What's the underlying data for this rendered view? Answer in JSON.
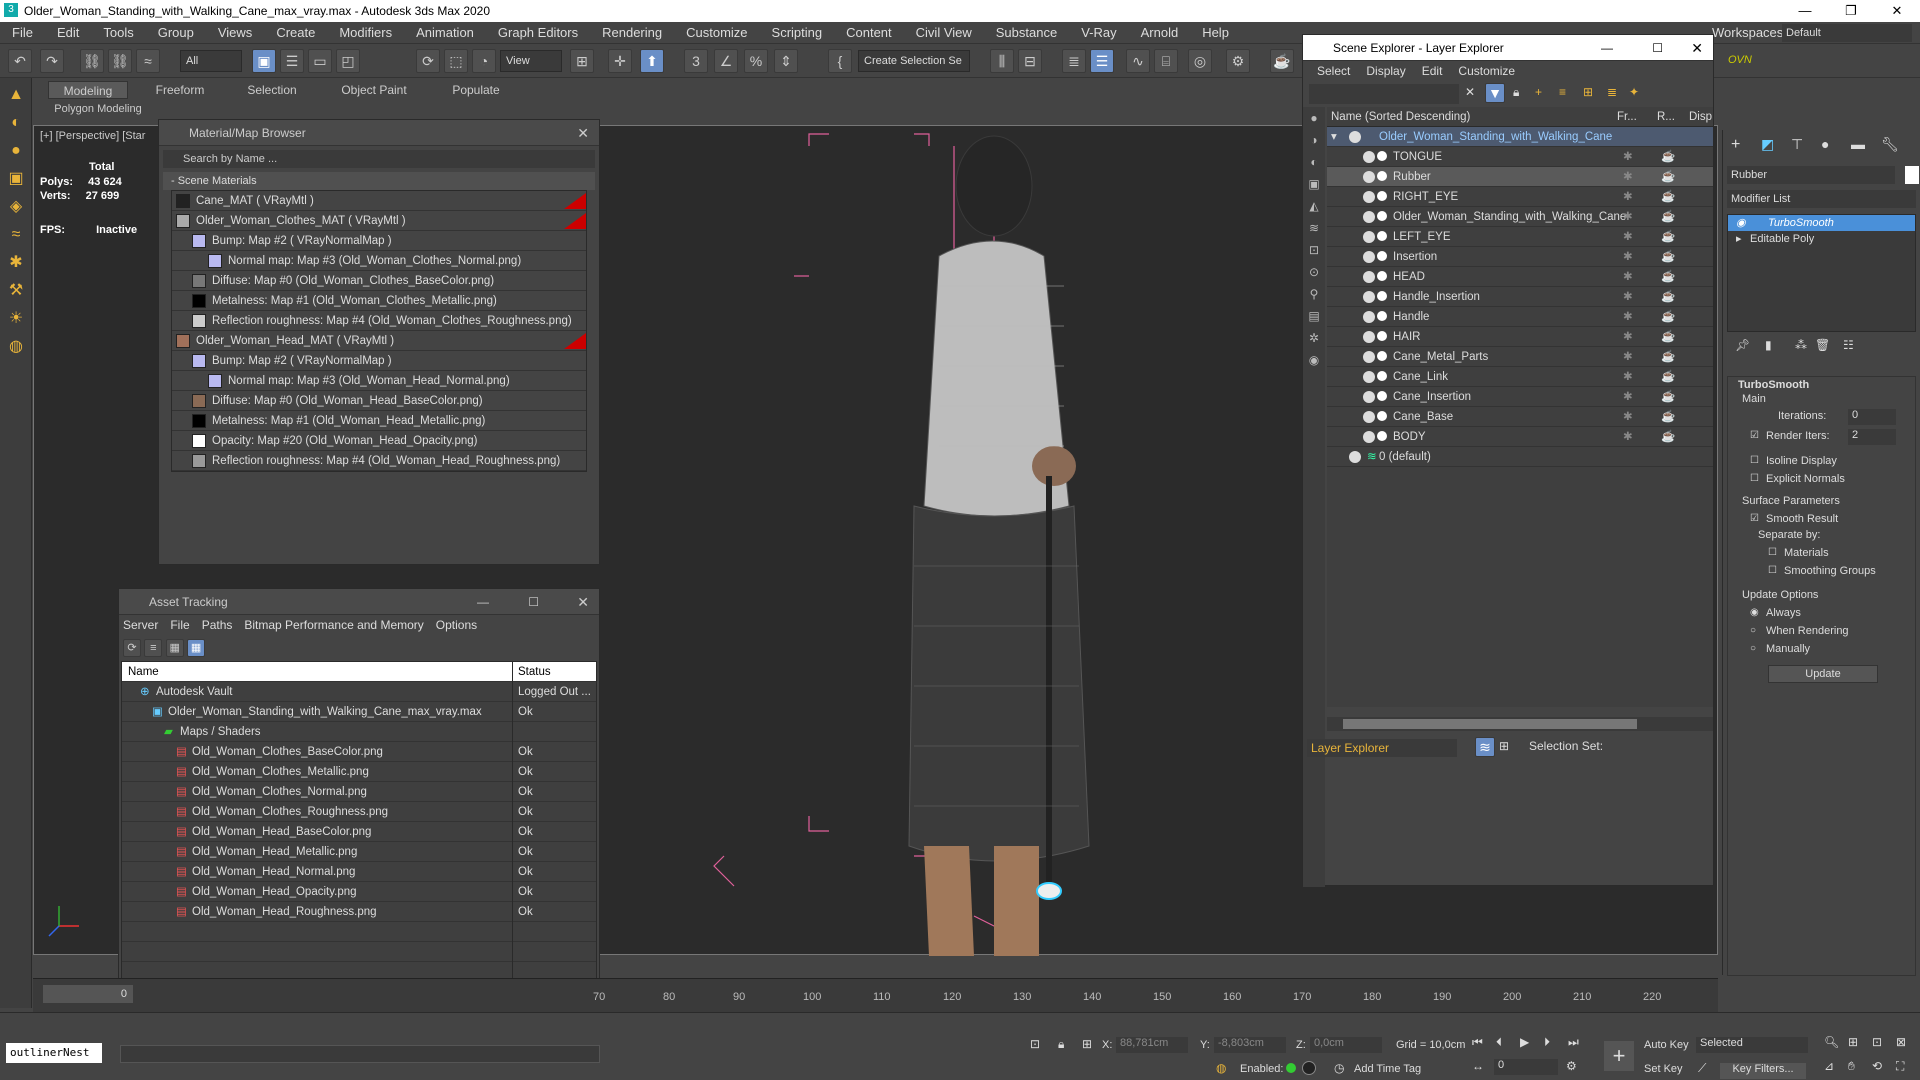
{
  "window": {
    "title": "Older_Woman_Standing_with_Walking_Cane_max_vray.max - Autodesk 3ds Max 2020",
    "workspace_label": "Workspaces:",
    "workspace": "Default"
  },
  "menu": [
    "File",
    "Edit",
    "Tools",
    "Group",
    "Views",
    "Create",
    "Modifiers",
    "Animation",
    "Graph Editors",
    "Rendering",
    "Customize",
    "Scripting",
    "Content",
    "Civil View",
    "Substance",
    "V-Ray",
    "Arnold",
    "Help"
  ],
  "toolbar": {
    "filter": "All",
    "view": "View",
    "selection_set": "Create Selection Se"
  },
  "ribbon": {
    "tabs": [
      "Modeling",
      "Freeform",
      "Selection",
      "Object Paint",
      "Populate"
    ],
    "sub": "Polygon Modeling"
  },
  "viewport": {
    "label": "[+] [Perspective] [Star",
    "stats": {
      "total": "Total",
      "polys_label": "Polys:",
      "polys": "43 624",
      "verts_label": "Verts:",
      "verts": "27 699",
      "fps_label": "FPS:",
      "fps": "Inactive"
    }
  },
  "material_browser": {
    "title": "Material/Map Browser",
    "search": "Search by Name ...",
    "section": "- Scene Materials",
    "items": [
      {
        "text": "Cane_MAT ( VRayMtl )",
        "indent": 0,
        "swatch": "#222",
        "red": true
      },
      {
        "text": "Older_Woman_Clothes_MAT ( VRayMtl )",
        "indent": 0,
        "swatch": "#aaa",
        "red": true
      },
      {
        "text": "Bump: Map #2 ( VRayNormalMap )",
        "indent": 1,
        "swatch": "#b9b9f0",
        "red": false
      },
      {
        "text": "Normal map: Map #3 (Old_Woman_Clothes_Normal.png)",
        "indent": 2,
        "swatch": "#b9b9f0",
        "red": false
      },
      {
        "text": "Diffuse: Map #0 (Old_Woman_Clothes_BaseColor.png)",
        "indent": 1,
        "swatch": "#777",
        "red": false
      },
      {
        "text": "Metalness: Map #1 (Old_Woman_Clothes_Metallic.png)",
        "indent": 1,
        "swatch": "#000",
        "red": false
      },
      {
        "text": "Reflection roughness: Map #4 (Old_Woman_Clothes_Roughness.png)",
        "indent": 1,
        "swatch": "#ccc",
        "red": false
      },
      {
        "text": "Older_Woman_Head_MAT ( VRayMtl )",
        "indent": 0,
        "swatch": "#a0705a",
        "red": true
      },
      {
        "text": "Bump: Map #2 ( VRayNormalMap )",
        "indent": 1,
        "swatch": "#b9b9f0",
        "red": false
      },
      {
        "text": "Normal map: Map #3 (Old_Woman_Head_Normal.png)",
        "indent": 2,
        "swatch": "#b9b9f0",
        "red": false
      },
      {
        "text": "Diffuse: Map #0 (Old_Woman_Head_BaseColor.png)",
        "indent": 1,
        "swatch": "#8a6a55",
        "red": false
      },
      {
        "text": "Metalness: Map #1 (Old_Woman_Head_Metallic.png)",
        "indent": 1,
        "swatch": "#000",
        "red": false
      },
      {
        "text": "Opacity: Map #20 (Old_Woman_Head_Opacity.png)",
        "indent": 1,
        "swatch": "#fff",
        "red": false
      },
      {
        "text": "Reflection roughness: Map #4 (Old_Woman_Head_Roughness.png)",
        "indent": 1,
        "swatch": "#999",
        "red": false
      }
    ]
  },
  "asset_tracking": {
    "title": "Asset Tracking",
    "menu": [
      "Server",
      "File",
      "Paths",
      "Bitmap Performance and Memory",
      "Options"
    ],
    "col_name": "Name",
    "col_status": "Status",
    "rows": [
      {
        "name": "Autodesk Vault",
        "status": "Logged Out ...",
        "indent": 1
      },
      {
        "name": "Older_Woman_Standing_with_Walking_Cane_max_vray.max",
        "status": "Ok",
        "indent": 2
      },
      {
        "name": "Maps / Shaders",
        "status": "",
        "indent": 3
      },
      {
        "name": "Old_Woman_Clothes_BaseColor.png",
        "status": "Ok",
        "indent": 4
      },
      {
        "name": "Old_Woman_Clothes_Metallic.png",
        "status": "Ok",
        "indent": 4
      },
      {
        "name": "Old_Woman_Clothes_Normal.png",
        "status": "Ok",
        "indent": 4
      },
      {
        "name": "Old_Woman_Clothes_Roughness.png",
        "status": "Ok",
        "indent": 4
      },
      {
        "name": "Old_Woman_Head_BaseColor.png",
        "status": "Ok",
        "indent": 4
      },
      {
        "name": "Old_Woman_Head_Metallic.png",
        "status": "Ok",
        "indent": 4
      },
      {
        "name": "Old_Woman_Head_Normal.png",
        "status": "Ok",
        "indent": 4
      },
      {
        "name": "Old_Woman_Head_Opacity.png",
        "status": "Ok",
        "indent": 4
      },
      {
        "name": "Old_Woman_Head_Roughness.png",
        "status": "Ok",
        "indent": 4
      }
    ]
  },
  "scene_explorer": {
    "title": "Scene Explorer - Layer Explorer",
    "menu": [
      "Select",
      "Display",
      "Edit",
      "Customize"
    ],
    "col_name": "Name (Sorted Descending)",
    "col_fr": "Fr...",
    "col_r": "R...",
    "col_disp": "Disp",
    "root": "Older_Woman_Standing_with_Walking_Cane",
    "items": [
      "TONGUE",
      "Rubber",
      "RIGHT_EYE",
      "Older_Woman_Standing_with_Walking_Cane",
      "LEFT_EYE",
      "Insertion",
      "HEAD",
      "Handle_Insertion",
      "Handle",
      "HAIR",
      "Cane_Metal_Parts",
      "Cane_Link",
      "Cane_Insertion",
      "Cane_Base",
      "BODY"
    ],
    "selected": "Rubber",
    "default_layer": "0 (default)",
    "footer": "Layer Explorer",
    "selection_set": "Selection Set:"
  },
  "command_panel": {
    "object_name": "Rubber",
    "modifier_list": "Modifier List",
    "stack": [
      "TurboSmooth",
      "Editable Poly"
    ],
    "rollout": "TurboSmooth",
    "main": "Main",
    "iterations_label": "Iterations:",
    "iterations": "0",
    "render_iters_label": "Render Iters:",
    "render_iters": "2",
    "isoline": "Isoline Display",
    "explicit": "Explicit Normals",
    "surface": "Surface Parameters",
    "smooth": "Smooth Result",
    "separate": "Separate by:",
    "materials": "Materials",
    "smoothing": "Smoothing Groups",
    "update_options": "Update Options",
    "always": "Always",
    "when_rendering": "When Rendering",
    "manually": "Manually",
    "update": "Update"
  },
  "timeline": {
    "frame": "0",
    "ticks": [
      "70",
      "80",
      "90",
      "100",
      "110",
      "120",
      "130",
      "140",
      "150",
      "160",
      "170",
      "180",
      "190",
      "200",
      "210",
      "220"
    ]
  },
  "status": {
    "x_label": "X:",
    "x": "88,781cm",
    "y_label": "Y:",
    "y": "-8,803cm",
    "z_label": "Z:",
    "z": "0,0cm",
    "grid": "Grid = 10,0cm",
    "enabled": "Enabled:",
    "add_time_tag": "Add Time Tag",
    "auto_key": "Auto Key",
    "selected": "Selected",
    "set_key": "Set Key",
    "key_filters": "Key Filters...",
    "frame": "0",
    "script": "outlinerNest"
  }
}
